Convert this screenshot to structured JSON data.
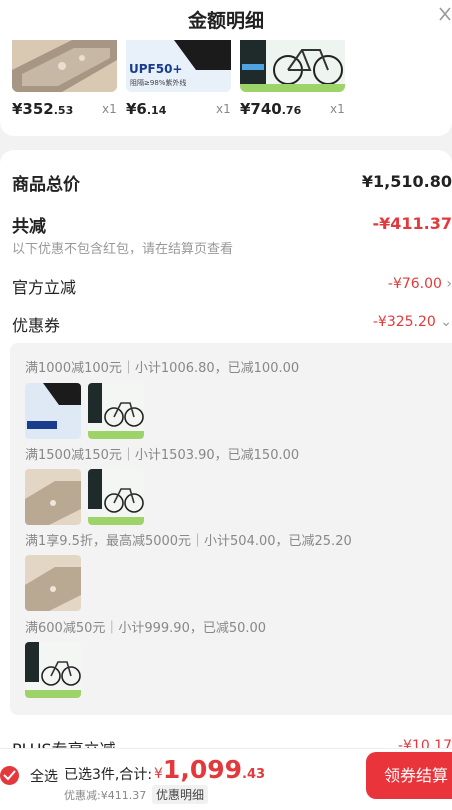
{
  "header": {
    "title": "金额明细",
    "close_icon": "close-icon"
  },
  "products": [
    {
      "price_main": "¥352",
      "price_dec": ".53",
      "qty": "x1"
    },
    {
      "price_main": "¥6",
      "price_dec": ".14",
      "qty": "x1",
      "thumb_text": "UPF50+",
      "thumb_sub": "阻隔≥98%紫外线"
    },
    {
      "price_main": "¥740",
      "price_dec": ".76",
      "qty": "x1"
    }
  ],
  "summary": {
    "goods_total_label": "商品总价",
    "goods_total_value": "¥1,510.80",
    "total_reduce_label": "共减",
    "total_reduce_value": "-¥411.37",
    "note": "以下优惠不包含红包，请在结算页查看",
    "official_label": "官方立减",
    "official_value": "-¥76.00",
    "coupon_label": "优惠券",
    "coupon_value": "-¥325.20",
    "plus_label": "PLUS专享立减",
    "plus_value": "-¥10.17"
  },
  "breakdown": [
    {
      "text": "满1000减100元｜小计1006.80，已减100.00"
    },
    {
      "text": "满1500减150元｜小计1503.90，已减150.00"
    },
    {
      "text": "满1享9.5折，最高减5000元｜小计504.00，已减25.20"
    },
    {
      "text": "满600减50元｜小计999.90，已减50.00"
    }
  ],
  "footer": {
    "select_all": "全选",
    "selected": "已选3件,合计:",
    "currency": "¥",
    "total_main": "1,099",
    "total_dec": ".43",
    "discount": "优惠减:¥411.37",
    "detail_button": "优惠明细",
    "checkout_button": "领券结算"
  },
  "colors": {
    "accent": "#e4393c"
  }
}
